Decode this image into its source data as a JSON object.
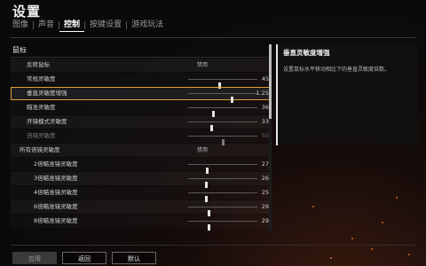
{
  "header": {
    "title": "设置"
  },
  "tabs": [
    {
      "label": "图像",
      "active": false
    },
    {
      "label": "声音",
      "active": false
    },
    {
      "label": "控制",
      "active": true
    },
    {
      "label": "按键设置",
      "active": false
    },
    {
      "label": "游戏玩法",
      "active": false
    }
  ],
  "section": {
    "title": "鼠标"
  },
  "rows": {
    "invert": {
      "label": "反转鼠标",
      "value": "禁用"
    },
    "normal": {
      "label": "常规灵敏度",
      "value": "45",
      "level": 0.45
    },
    "vertical": {
      "label": "垂直灵敏度增强",
      "value": "1.25",
      "level": 0.63
    },
    "aim": {
      "label": "瞄准灵敏度",
      "value": "36",
      "level": 0.36
    },
    "scopeOpen": {
      "label": "开镜模式灵敏度",
      "value": "33",
      "level": 0.33
    },
    "scope": {
      "label": "倍镜灵敏度",
      "value": "50",
      "level": 0.5
    },
    "allScope": {
      "label": "所有倍镜灵敏度",
      "value": "禁用"
    },
    "s2": {
      "label": "2倍瞄准镜灵敏度",
      "value": "27",
      "level": 0.27
    },
    "s3": {
      "label": "3倍瞄准镜灵敏度",
      "value": "26",
      "level": 0.26
    },
    "s4": {
      "label": "4倍瞄准镜灵敏度",
      "value": "25",
      "level": 0.25
    },
    "s6": {
      "label": "6倍瞄准镜灵敏度",
      "value": "29",
      "level": 0.29
    },
    "s8": {
      "label": "8倍瞄准镜灵敏度",
      "value": "29",
      "level": 0.29
    }
  },
  "description": {
    "title": "垂直灵敏度增强",
    "text": "设置鼠标水平移动相比下的垂直灵敏度倍数。"
  },
  "footer": {
    "apply": "应用",
    "back": "返回",
    "default": "默认"
  },
  "colors": {
    "highlight": "#e0a030",
    "ember": "#ff7a2a"
  }
}
